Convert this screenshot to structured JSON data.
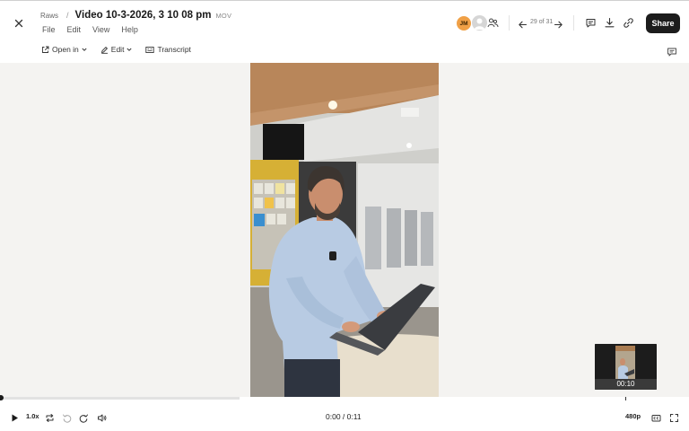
{
  "header": {
    "breadcrumb_parent": "Raws",
    "breadcrumb_separator": "/",
    "title": "Video 10-3-2026, 3 10 08 pm",
    "file_type": "MOV",
    "menu": [
      "File",
      "Edit",
      "View",
      "Help"
    ],
    "avatar_initials": "JM",
    "avatar_color": "#f0a046",
    "nav_counter": "29 of 31",
    "share_label": "Share",
    "icons": [
      "close-icon",
      "people-icon",
      "arrow-left-icon",
      "arrow-right-icon",
      "comment-icon",
      "download-icon",
      "link-icon"
    ]
  },
  "subtoolbar": {
    "open_in_label": "Open in",
    "edit_label": "Edit",
    "transcript_label": "Transcript"
  },
  "preview": {
    "thumbnail_time": "00:10"
  },
  "player": {
    "speed": "1.0x",
    "current_time": "0:00",
    "time_separator": "/",
    "duration": "0:11",
    "timecode": "0:00 / 0:11",
    "quality": "480p",
    "progress": 0.0,
    "icons": [
      "play-icon",
      "loop-icon",
      "rewind-icon",
      "forward-icon",
      "volume-icon",
      "captions-icon",
      "fullscreen-icon"
    ]
  },
  "colors": {
    "share_button": "#1c1c1c",
    "stage_background": "#f4f3f1"
  }
}
